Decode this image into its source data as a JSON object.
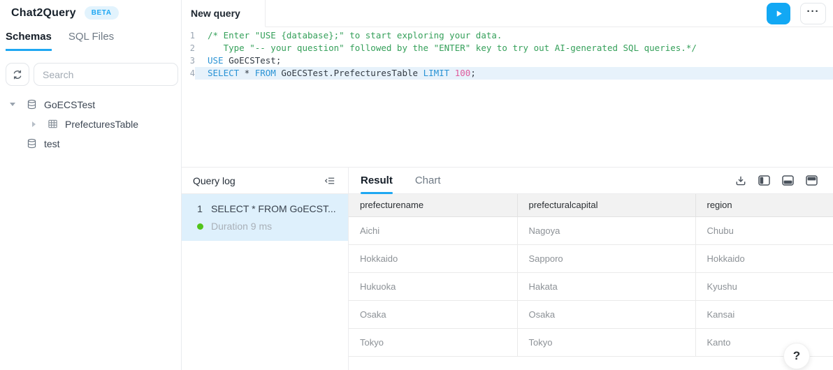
{
  "app": {
    "title": "Chat2Query",
    "badge": "BETA"
  },
  "sidebar": {
    "tabs": [
      {
        "label": "Schemas",
        "active": true
      },
      {
        "label": "SQL Files",
        "active": false
      }
    ],
    "search": {
      "placeholder": "Search"
    },
    "tree": [
      {
        "label": "GoECSTest",
        "type": "database",
        "expanded": true
      },
      {
        "label": "PrefecturesTable",
        "type": "table",
        "expanded": false
      },
      {
        "label": "test",
        "type": "database",
        "expanded": false
      }
    ]
  },
  "toolbar": {
    "tab_label": "New query",
    "more_label": "···"
  },
  "editor": {
    "lines": [
      {
        "num": "1",
        "tokens": [
          {
            "t": "/* Enter \"USE {database};\" to start exploring your data.",
            "c": "comment"
          }
        ]
      },
      {
        "num": "2",
        "tokens": [
          {
            "t": "   Type \"-- your question\" followed by the \"ENTER\" key to try out AI-generated SQL queries.*/",
            "c": "comment"
          }
        ]
      },
      {
        "num": "3",
        "tokens": [
          {
            "t": "USE",
            "c": "kw"
          },
          {
            "t": " GoECSTest;",
            "c": "pl"
          }
        ]
      },
      {
        "num": "4",
        "tokens": [
          {
            "t": "SELECT",
            "c": "kw"
          },
          {
            "t": " * ",
            "c": "pl"
          },
          {
            "t": "FROM",
            "c": "kw"
          },
          {
            "t": " GoECSTest.PrefecturesTable ",
            "c": "pl"
          },
          {
            "t": "LIMIT",
            "c": "kw"
          },
          {
            "t": " ",
            "c": "pl"
          },
          {
            "t": "100",
            "c": "num"
          },
          {
            "t": ";",
            "c": "pl"
          }
        ]
      }
    ]
  },
  "query_log": {
    "title": "Query log",
    "entry": {
      "index": "1",
      "sql": "SELECT * FROM GoECST...",
      "duration": "Duration 9 ms",
      "status": "success",
      "selected": true
    }
  },
  "result": {
    "tabs": [
      {
        "label": "Result",
        "active": true
      },
      {
        "label": "Chart",
        "active": false
      }
    ],
    "table": {
      "columns": [
        "prefecturename",
        "prefecturalcapital",
        "region"
      ],
      "rows": [
        [
          "Aichi",
          "Nagoya",
          "Chubu"
        ],
        [
          "Hokkaido",
          "Sapporo",
          "Hokkaido"
        ],
        [
          "Hukuoka",
          "Hakata",
          "Kyushu"
        ],
        [
          "Osaka",
          "Osaka",
          "Kansai"
        ],
        [
          "Tokyo",
          "Tokyo",
          "Kanto"
        ]
      ]
    },
    "icons": [
      "download-icon",
      "layout-left-icon",
      "layout-bottom-icon",
      "layout-top-icon"
    ]
  },
  "help": {
    "label": "?"
  },
  "colors": {
    "accent": "#1ea7f2",
    "keyword": "#2a93d5",
    "comment": "#35a05a",
    "number": "#df5c9d",
    "line_highlight": "#e7f2fb",
    "entry_bg": "#def0fc",
    "success": "#52c41a",
    "badge_bg": "#e2f3fd"
  }
}
